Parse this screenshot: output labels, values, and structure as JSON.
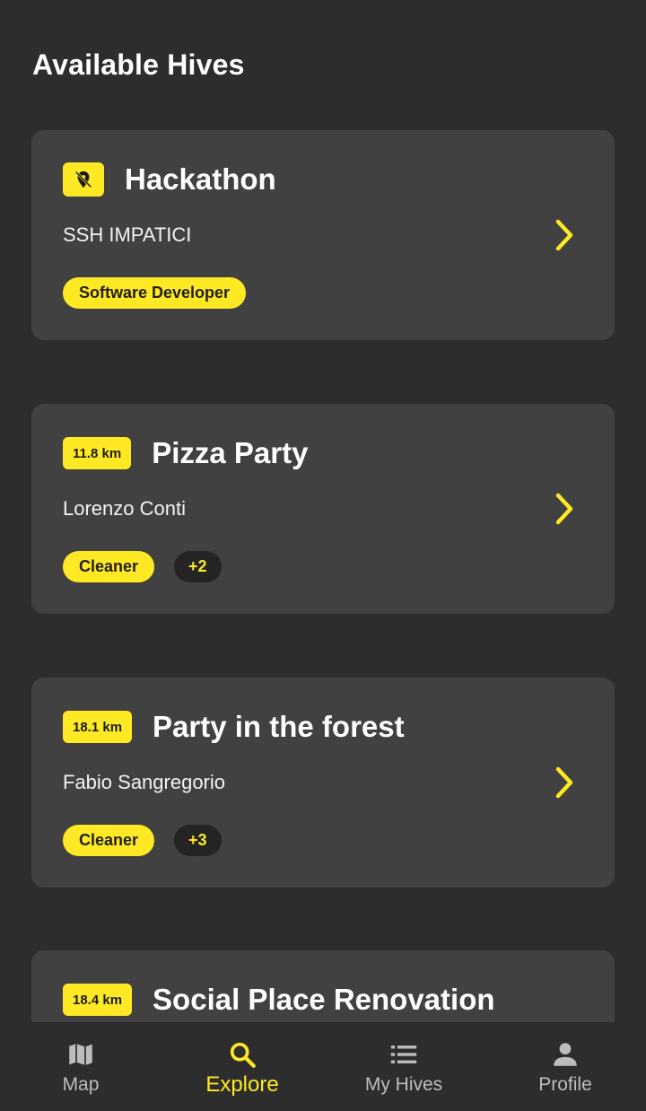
{
  "page": {
    "title": "Available Hives"
  },
  "hives": [
    {
      "badge_type": "icon",
      "badge_icon": "location-off-icon",
      "title": "Hackathon",
      "owner": "SSH IMPATICI",
      "roles": [
        "Software Developer"
      ],
      "more": ""
    },
    {
      "badge_type": "distance",
      "distance": "11.8 km",
      "title": "Pizza Party",
      "owner": "Lorenzo Conti",
      "roles": [
        "Cleaner"
      ],
      "more": "+2"
    },
    {
      "badge_type": "distance",
      "distance": "18.1 km",
      "title": "Party in the forest",
      "owner": "Fabio Sangregorio",
      "roles": [
        "Cleaner"
      ],
      "more": "+3"
    },
    {
      "badge_type": "distance",
      "distance": "18.4 km",
      "title": "Social Place Renovation",
      "owner": "",
      "roles": [],
      "more": ""
    }
  ],
  "nav": {
    "items": [
      {
        "label": "Map",
        "icon": "map-icon",
        "active": false
      },
      {
        "label": "Explore",
        "icon": "search-icon",
        "active": true
      },
      {
        "label": "My Hives",
        "icon": "list-icon",
        "active": false
      },
      {
        "label": "Profile",
        "icon": "person-icon",
        "active": false
      }
    ]
  },
  "colors": {
    "background": "#2d2d2d",
    "card": "#414141",
    "accent": "#ffe924",
    "more_tag": "#242424",
    "nav_inactive": "#bdbdbd"
  }
}
